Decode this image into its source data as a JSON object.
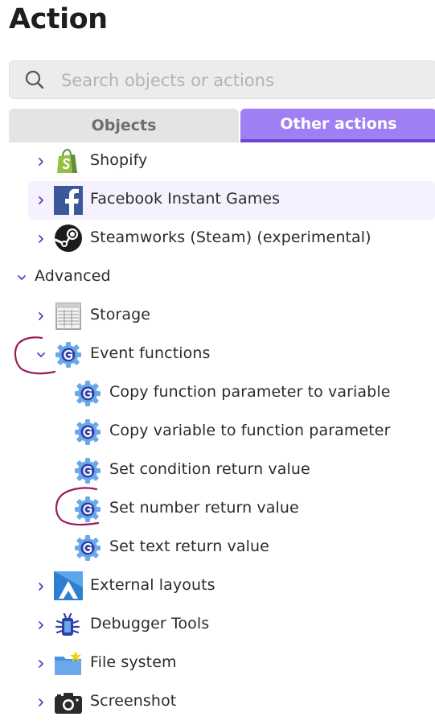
{
  "title": "Action",
  "search": {
    "placeholder": "Search objects or actions"
  },
  "tabs": {
    "objects": "Objects",
    "other_actions": "Other actions"
  },
  "tree": {
    "shopify": "Shopify",
    "facebook": "Facebook Instant Games",
    "steamworks": "Steamworks (Steam) (experimental)",
    "advanced": "Advanced",
    "storage": "Storage",
    "event_functions": "Event functions",
    "copy_param_to_var": "Copy function parameter to variable",
    "copy_var_to_param": "Copy variable to function parameter",
    "set_condition_return": "Set condition return value",
    "set_number_return": "Set number return value",
    "set_text_return": "Set text return value",
    "external_layouts": "External layouts",
    "debugger_tools": "Debugger Tools",
    "file_system": "File system",
    "screenshot": "Screenshot"
  },
  "colors": {
    "accent": "#a07ff5",
    "accent_dark": "#6b46d6",
    "chevron": "#5b3fc7",
    "annotation": "#9a1a5e"
  }
}
